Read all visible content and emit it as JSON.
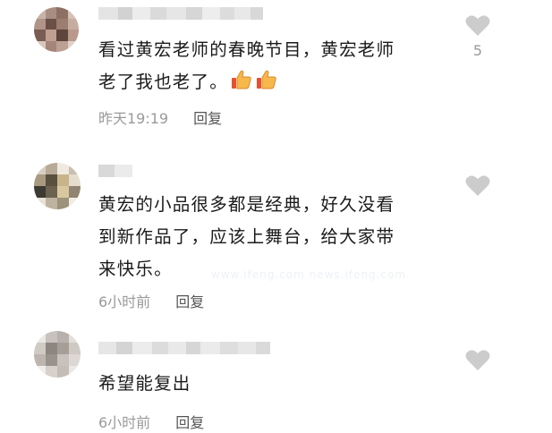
{
  "comments": [
    {
      "text": "看过黄宏老师的春晚节目，黄宏老师\n老了我也老了。",
      "emoji": [
        "thumbs-up",
        "thumbs-up"
      ],
      "time": "昨天19:19",
      "reply_label": "回复",
      "likes": "5"
    },
    {
      "text": "黄宏的小品很多都是经典，好久没看\n到新作品了，应该上舞台，给大家带\n来快乐。",
      "time": "6小时前",
      "reply_label": "回复",
      "likes": ""
    },
    {
      "text": "希望能复出",
      "time": "6小时前",
      "reply_label": "回复",
      "likes": ""
    }
  ],
  "watermark": "www.ifeng.com news.ifeng.com",
  "colors": {
    "text": "#1a1a1a",
    "meta": "#9a9a9a",
    "reply": "#555555",
    "heart": "#cccccc"
  }
}
